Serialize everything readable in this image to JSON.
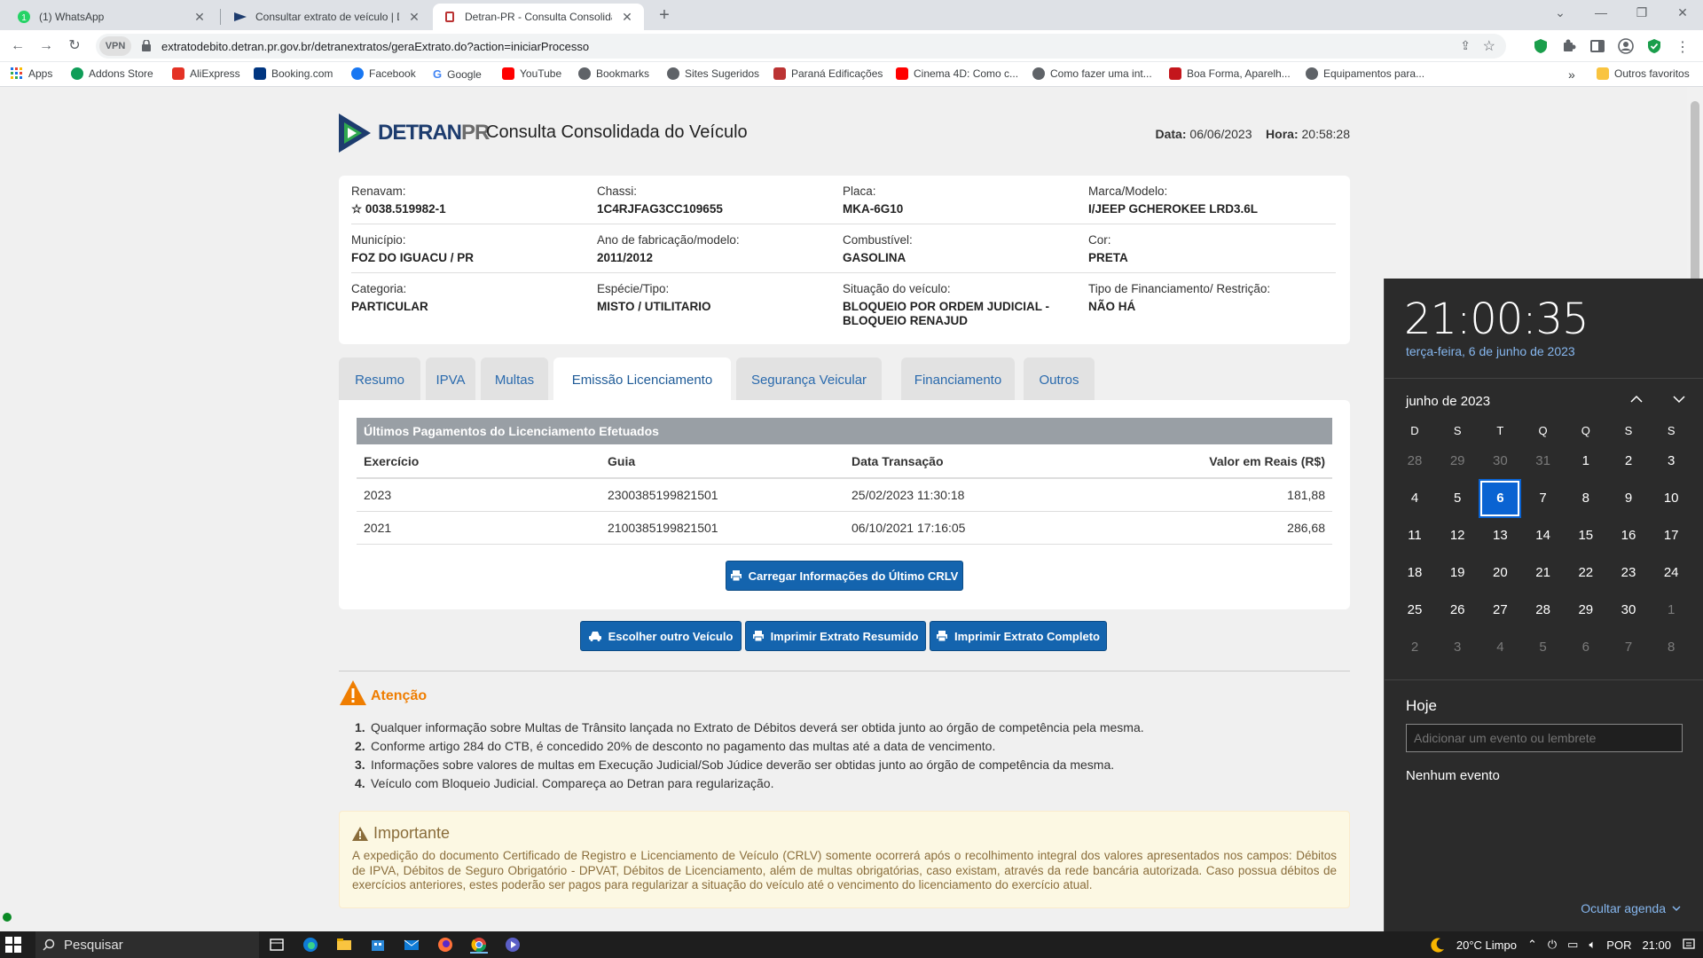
{
  "browser": {
    "tabs": [
      {
        "title": "(1) WhatsApp"
      },
      {
        "title": "Consultar extrato de veículo | DE"
      },
      {
        "title": "Detran-PR - Consulta Consolidad"
      }
    ],
    "vpn_label": "VPN",
    "url": "extratodebito.detran.pr.gov.br/detranextratos/geraExtrato.do?action=iniciarProcesso",
    "bookmarks": [
      "Apps",
      "Addons Store",
      "AliExpress",
      "Booking.com",
      "Facebook",
      "Google",
      "YouTube",
      "Bookmarks",
      "Sites Sugeridos",
      "Paraná Edificações",
      "Cinema 4D: Como c...",
      "Como fazer uma int...",
      "Boa Forma, Aparelh...",
      "Equipamentos para..."
    ],
    "more_bookmarks": "»",
    "other_favorites": "Outros favoritos"
  },
  "header": {
    "logo_main": "DETRAN",
    "logo_pr": "PR",
    "title": "Consulta Consolidada do Veículo",
    "data_label": "Data:",
    "data_value": "06/06/2023",
    "hora_label": "Hora:",
    "hora_value": "20:58:28"
  },
  "vehicle": {
    "rows": [
      [
        {
          "label": "Renavam:",
          "value": "☆ 0038.519982-1"
        },
        {
          "label": "Chassi:",
          "value": "1C4RJFAG3CC109655"
        },
        {
          "label": "Placa:",
          "value": "MKA-6G10"
        },
        {
          "label": "Marca/Modelo:",
          "value": "I/JEEP GCHEROKEE LRD3.6L"
        }
      ],
      [
        {
          "label": "Município:",
          "value": "FOZ DO IGUACU / PR"
        },
        {
          "label": "Ano de fabricação/modelo:",
          "value": "2011/2012"
        },
        {
          "label": "Combustível:",
          "value": "GASOLINA"
        },
        {
          "label": "Cor:",
          "value": "PRETA"
        }
      ],
      [
        {
          "label": "Categoria:",
          "value": "PARTICULAR"
        },
        {
          "label": "Espécie/Tipo:",
          "value": "MISTO / UTILITARIO"
        },
        {
          "label": "Situação do veículo:",
          "value": "BLOQUEIO POR ORDEM JUDICIAL - BLOQUEIO RENAJUD"
        },
        {
          "label": "Tipo de Financiamento/ Restrição:",
          "value": "NÃO HÁ"
        }
      ]
    ]
  },
  "tabs": [
    "Resumo",
    "IPVA",
    "Multas",
    "Emissão Licenciamento",
    "Segurança Veicular",
    "Financiamento",
    "Outros"
  ],
  "licenciamento": {
    "section_title": "Últimos Pagamentos do Licenciamento Efetuados",
    "columns": [
      "Exercício",
      "Guia",
      "Data Transação",
      "Valor em Reais (R$)"
    ],
    "rows": [
      [
        "2023",
        "2300385199821501",
        "25/02/2023 11:30:18",
        "181,88"
      ],
      [
        "2021",
        "2100385199821501",
        "06/10/2021 17:16:05",
        "286,68"
      ]
    ],
    "load_button": "Carregar Informações do Último CRLV"
  },
  "actions": {
    "choose": "Escolher outro Veículo",
    "print_summary": "Imprimir Extrato Resumido",
    "print_full": "Imprimir Extrato Completo"
  },
  "attention": {
    "title": "Atenção",
    "items": [
      "Qualquer informação sobre Multas de Trânsito lançada no Extrato de Débitos deverá ser obtida junto ao órgão de competência pela mesma.",
      "Conforme artigo 284 do CTB, é concedido 20% de desconto no pagamento das multas até a data de vencimento.",
      "Informações sobre valores de multas em Execução Judicial/Sob Júdice deverão ser obtidas junto ao órgão de competência da mesma.",
      "Veículo com Bloqueio Judicial. Compareça ao Detran para regularização."
    ]
  },
  "important": {
    "title": "Importante",
    "text": "A expedição do documento Certificado de Registro e Licenciamento de Veículo (CRLV) somente ocorrerá após o recolhimento integral dos valores apresentados nos campos: Débitos de IPVA, Débitos de Seguro Obrigatório - DPVAT, Débitos de Licenciamento, além de multas obrigatórias, caso existam, através da rede bancária autorizada. Caso possua débitos de exercícios anteriores, estes poderão ser pagos para regularizar a situação do veículo até o vencimento do licenciamento do exercício atual."
  },
  "calendar": {
    "time": "21:00:35",
    "date_long": "terça-feira, 6 de junho de 2023",
    "month": "junho de 2023",
    "weekdays": [
      "D",
      "S",
      "T",
      "Q",
      "Q",
      "S",
      "S"
    ],
    "days": [
      [
        "28",
        "29",
        "30",
        "31",
        "1",
        "2",
        "3"
      ],
      [
        "4",
        "5",
        "6",
        "7",
        "8",
        "9",
        "10"
      ],
      [
        "11",
        "12",
        "13",
        "14",
        "15",
        "16",
        "17"
      ],
      [
        "18",
        "19",
        "20",
        "21",
        "22",
        "23",
        "24"
      ],
      [
        "25",
        "26",
        "27",
        "28",
        "29",
        "30",
        "1"
      ],
      [
        "2",
        "3",
        "4",
        "5",
        "6",
        "7",
        "8"
      ]
    ],
    "today": "6",
    "today_label": "Hoje",
    "event_placeholder": "Adicionar um evento ou lembrete",
    "no_events": "Nenhum evento",
    "hide_agenda": "Ocultar agenda"
  },
  "taskbar": {
    "search": "Pesquisar",
    "weather": "20°C  Limpo",
    "lang": "POR",
    "time": "21:00"
  }
}
